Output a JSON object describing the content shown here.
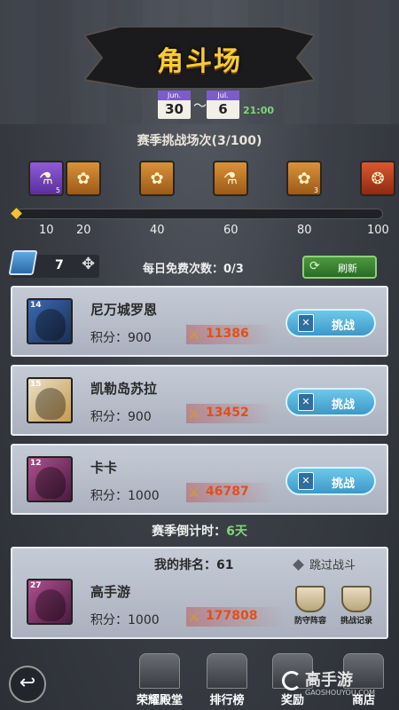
{
  "header": {
    "title": "角斗场"
  },
  "season": {
    "start_month": "Jun.",
    "start_day": "30",
    "separator": "〜",
    "end_month": "Jul.",
    "end_day": "6",
    "end_time": "21:00",
    "battle_count": "赛季挑战场次(3/100)"
  },
  "rewards": [
    {
      "icon": "potion-icon",
      "count": "5"
    },
    {
      "icon": "rosette-icon",
      "count": ""
    },
    {
      "icon": "rosette-icon",
      "count": ""
    },
    {
      "icon": "potion-icon",
      "count": ""
    },
    {
      "icon": "rosette-icon",
      "count": "3"
    },
    {
      "icon": "monster-icon",
      "count": ""
    }
  ],
  "progress": {
    "fraction": 0.0,
    "ticks": [
      "10",
      "20",
      "40",
      "60",
      "80",
      "100"
    ]
  },
  "tickets": {
    "count": "7",
    "plus": "✥"
  },
  "free_times": "每日免费次数：0/3",
  "refresh_label": "刷新",
  "opponents": [
    {
      "level": "14",
      "name": "尼万城罗恩",
      "score_label": "积分：900",
      "power": "11386",
      "challenge": "挑战"
    },
    {
      "level": "15",
      "name": "凯勒岛苏拉",
      "score_label": "积分：900",
      "power": "13452",
      "challenge": "挑战"
    },
    {
      "level": "12",
      "name": "卡卡",
      "score_label": "积分：1000",
      "power": "46787",
      "challenge": "挑战"
    }
  ],
  "countdown": {
    "label": "赛季倒计时：",
    "value": "6天"
  },
  "me": {
    "rank_label": "我的排名：61",
    "skip_label": "跳过战斗",
    "level": "27",
    "name": "高手游",
    "score_label": "积分：1000",
    "power": "177808",
    "defense_label": "防守阵容",
    "record_label": "挑战记录"
  },
  "nav": {
    "back": "↩",
    "items": [
      "荣耀殿堂",
      "排行榜",
      "奖励",
      "商店"
    ]
  },
  "watermark": {
    "text": "高手游",
    "sub": "GAOSHOUYOU.COM"
  },
  "colors": {
    "accent_gold": "#f5cc3a",
    "power_red": "#e0501c",
    "time_green": "#7fd67a",
    "challenge_blue": "#3d98c7"
  }
}
